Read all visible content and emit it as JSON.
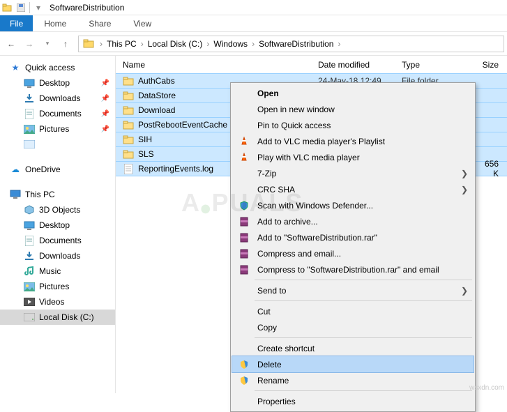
{
  "title": "SoftwareDistribution",
  "menubar": {
    "file": "File",
    "home": "Home",
    "share": "Share",
    "view": "View"
  },
  "breadcrumbs": [
    "This PC",
    "Local Disk (C:)",
    "Windows",
    "SoftwareDistribution"
  ],
  "columns": {
    "name": "Name",
    "date": "Date modified",
    "type": "Type",
    "size": "Size"
  },
  "rows": [
    {
      "name": "AuthCabs",
      "date": "24-May-18 12:49",
      "type": "File folder",
      "size": "",
      "icon": "folder"
    },
    {
      "name": "DataStore",
      "date": "",
      "type": "",
      "size": "",
      "icon": "folder"
    },
    {
      "name": "Download",
      "date": "",
      "type": "",
      "size": "",
      "icon": "folder"
    },
    {
      "name": "PostRebootEventCache",
      "date": "",
      "type": "",
      "size": "",
      "icon": "folder"
    },
    {
      "name": "SIH",
      "date": "",
      "type": "",
      "size": "",
      "icon": "folder"
    },
    {
      "name": "SLS",
      "date": "",
      "type": "",
      "size": "",
      "icon": "folder"
    },
    {
      "name": "ReportingEvents.log",
      "date": "",
      "type": "",
      "size": "656 K",
      "icon": "file"
    }
  ],
  "sidebar": {
    "quick": "Quick access",
    "quick_items": [
      {
        "label": "Desktop",
        "pin": true,
        "icon": "desktop"
      },
      {
        "label": "Downloads",
        "pin": true,
        "icon": "downloads"
      },
      {
        "label": "Documents",
        "pin": true,
        "icon": "documents"
      },
      {
        "label": "Pictures",
        "pin": true,
        "icon": "pictures"
      }
    ],
    "onedrive": "OneDrive",
    "thispc": "This PC",
    "pc_items": [
      {
        "label": "3D Objects",
        "icon": "3d"
      },
      {
        "label": "Desktop",
        "icon": "desktop"
      },
      {
        "label": "Documents",
        "icon": "documents"
      },
      {
        "label": "Downloads",
        "icon": "downloads"
      },
      {
        "label": "Music",
        "icon": "music"
      },
      {
        "label": "Pictures",
        "icon": "pictures"
      },
      {
        "label": "Videos",
        "icon": "videos"
      },
      {
        "label": "Local Disk (C:)",
        "icon": "disk",
        "sel": true
      }
    ]
  },
  "context_menu": [
    {
      "label": "Open",
      "bold": true
    },
    {
      "label": "Open in new window"
    },
    {
      "label": "Pin to Quick access"
    },
    {
      "label": "Add to VLC media player's Playlist",
      "icon": "vlc"
    },
    {
      "label": "Play with VLC media player",
      "icon": "vlc"
    },
    {
      "label": "7-Zip",
      "submenu": true
    },
    {
      "label": "CRC SHA",
      "submenu": true
    },
    {
      "label": "Scan with Windows Defender...",
      "icon": "shield"
    },
    {
      "label": "Add to archive...",
      "icon": "rar"
    },
    {
      "label": "Add to \"SoftwareDistribution.rar\"",
      "icon": "rar"
    },
    {
      "label": "Compress and email...",
      "icon": "rar"
    },
    {
      "label": "Compress to \"SoftwareDistribution.rar\" and email",
      "icon": "rar"
    },
    {
      "sep": true
    },
    {
      "label": "Send to",
      "submenu": true
    },
    {
      "sep": true
    },
    {
      "label": "Cut"
    },
    {
      "label": "Copy"
    },
    {
      "sep": true
    },
    {
      "label": "Create shortcut"
    },
    {
      "label": "Delete",
      "icon": "uac",
      "hover": true
    },
    {
      "label": "Rename",
      "icon": "uac"
    },
    {
      "sep": true
    },
    {
      "label": "Properties"
    }
  ],
  "watermark": "A🟢PUALS",
  "footer": "wsxdn.com"
}
